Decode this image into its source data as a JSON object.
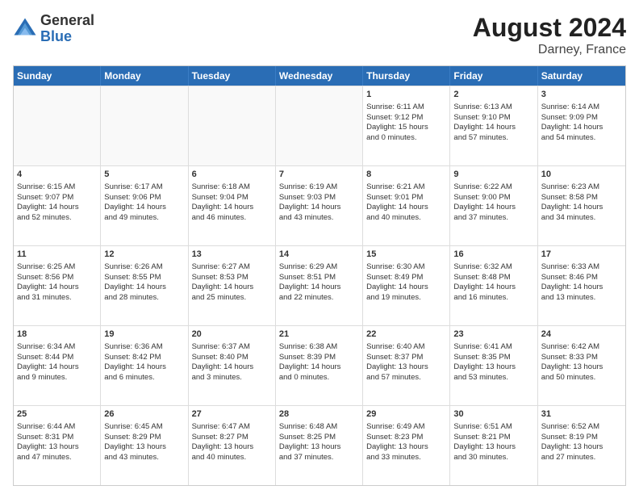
{
  "header": {
    "logo_general": "General",
    "logo_blue": "Blue",
    "title": "August 2024",
    "location": "Darney, France"
  },
  "days_of_week": [
    "Sunday",
    "Monday",
    "Tuesday",
    "Wednesday",
    "Thursday",
    "Friday",
    "Saturday"
  ],
  "weeks": [
    [
      {
        "num": "",
        "lines": [],
        "empty": true
      },
      {
        "num": "",
        "lines": [],
        "empty": true
      },
      {
        "num": "",
        "lines": [],
        "empty": true
      },
      {
        "num": "",
        "lines": [],
        "empty": true
      },
      {
        "num": "1",
        "lines": [
          "Sunrise: 6:11 AM",
          "Sunset: 9:12 PM",
          "Daylight: 15 hours",
          "and 0 minutes."
        ],
        "empty": false
      },
      {
        "num": "2",
        "lines": [
          "Sunrise: 6:13 AM",
          "Sunset: 9:10 PM",
          "Daylight: 14 hours",
          "and 57 minutes."
        ],
        "empty": false
      },
      {
        "num": "3",
        "lines": [
          "Sunrise: 6:14 AM",
          "Sunset: 9:09 PM",
          "Daylight: 14 hours",
          "and 54 minutes."
        ],
        "empty": false
      }
    ],
    [
      {
        "num": "4",
        "lines": [
          "Sunrise: 6:15 AM",
          "Sunset: 9:07 PM",
          "Daylight: 14 hours",
          "and 52 minutes."
        ],
        "empty": false
      },
      {
        "num": "5",
        "lines": [
          "Sunrise: 6:17 AM",
          "Sunset: 9:06 PM",
          "Daylight: 14 hours",
          "and 49 minutes."
        ],
        "empty": false
      },
      {
        "num": "6",
        "lines": [
          "Sunrise: 6:18 AM",
          "Sunset: 9:04 PM",
          "Daylight: 14 hours",
          "and 46 minutes."
        ],
        "empty": false
      },
      {
        "num": "7",
        "lines": [
          "Sunrise: 6:19 AM",
          "Sunset: 9:03 PM",
          "Daylight: 14 hours",
          "and 43 minutes."
        ],
        "empty": false
      },
      {
        "num": "8",
        "lines": [
          "Sunrise: 6:21 AM",
          "Sunset: 9:01 PM",
          "Daylight: 14 hours",
          "and 40 minutes."
        ],
        "empty": false
      },
      {
        "num": "9",
        "lines": [
          "Sunrise: 6:22 AM",
          "Sunset: 9:00 PM",
          "Daylight: 14 hours",
          "and 37 minutes."
        ],
        "empty": false
      },
      {
        "num": "10",
        "lines": [
          "Sunrise: 6:23 AM",
          "Sunset: 8:58 PM",
          "Daylight: 14 hours",
          "and 34 minutes."
        ],
        "empty": false
      }
    ],
    [
      {
        "num": "11",
        "lines": [
          "Sunrise: 6:25 AM",
          "Sunset: 8:56 PM",
          "Daylight: 14 hours",
          "and 31 minutes."
        ],
        "empty": false
      },
      {
        "num": "12",
        "lines": [
          "Sunrise: 6:26 AM",
          "Sunset: 8:55 PM",
          "Daylight: 14 hours",
          "and 28 minutes."
        ],
        "empty": false
      },
      {
        "num": "13",
        "lines": [
          "Sunrise: 6:27 AM",
          "Sunset: 8:53 PM",
          "Daylight: 14 hours",
          "and 25 minutes."
        ],
        "empty": false
      },
      {
        "num": "14",
        "lines": [
          "Sunrise: 6:29 AM",
          "Sunset: 8:51 PM",
          "Daylight: 14 hours",
          "and 22 minutes."
        ],
        "empty": false
      },
      {
        "num": "15",
        "lines": [
          "Sunrise: 6:30 AM",
          "Sunset: 8:49 PM",
          "Daylight: 14 hours",
          "and 19 minutes."
        ],
        "empty": false
      },
      {
        "num": "16",
        "lines": [
          "Sunrise: 6:32 AM",
          "Sunset: 8:48 PM",
          "Daylight: 14 hours",
          "and 16 minutes."
        ],
        "empty": false
      },
      {
        "num": "17",
        "lines": [
          "Sunrise: 6:33 AM",
          "Sunset: 8:46 PM",
          "Daylight: 14 hours",
          "and 13 minutes."
        ],
        "empty": false
      }
    ],
    [
      {
        "num": "18",
        "lines": [
          "Sunrise: 6:34 AM",
          "Sunset: 8:44 PM",
          "Daylight: 14 hours",
          "and 9 minutes."
        ],
        "empty": false
      },
      {
        "num": "19",
        "lines": [
          "Sunrise: 6:36 AM",
          "Sunset: 8:42 PM",
          "Daylight: 14 hours",
          "and 6 minutes."
        ],
        "empty": false
      },
      {
        "num": "20",
        "lines": [
          "Sunrise: 6:37 AM",
          "Sunset: 8:40 PM",
          "Daylight: 14 hours",
          "and 3 minutes."
        ],
        "empty": false
      },
      {
        "num": "21",
        "lines": [
          "Sunrise: 6:38 AM",
          "Sunset: 8:39 PM",
          "Daylight: 14 hours",
          "and 0 minutes."
        ],
        "empty": false
      },
      {
        "num": "22",
        "lines": [
          "Sunrise: 6:40 AM",
          "Sunset: 8:37 PM",
          "Daylight: 13 hours",
          "and 57 minutes."
        ],
        "empty": false
      },
      {
        "num": "23",
        "lines": [
          "Sunrise: 6:41 AM",
          "Sunset: 8:35 PM",
          "Daylight: 13 hours",
          "and 53 minutes."
        ],
        "empty": false
      },
      {
        "num": "24",
        "lines": [
          "Sunrise: 6:42 AM",
          "Sunset: 8:33 PM",
          "Daylight: 13 hours",
          "and 50 minutes."
        ],
        "empty": false
      }
    ],
    [
      {
        "num": "25",
        "lines": [
          "Sunrise: 6:44 AM",
          "Sunset: 8:31 PM",
          "Daylight: 13 hours",
          "and 47 minutes."
        ],
        "empty": false
      },
      {
        "num": "26",
        "lines": [
          "Sunrise: 6:45 AM",
          "Sunset: 8:29 PM",
          "Daylight: 13 hours",
          "and 43 minutes."
        ],
        "empty": false
      },
      {
        "num": "27",
        "lines": [
          "Sunrise: 6:47 AM",
          "Sunset: 8:27 PM",
          "Daylight: 13 hours",
          "and 40 minutes."
        ],
        "empty": false
      },
      {
        "num": "28",
        "lines": [
          "Sunrise: 6:48 AM",
          "Sunset: 8:25 PM",
          "Daylight: 13 hours",
          "and 37 minutes."
        ],
        "empty": false
      },
      {
        "num": "29",
        "lines": [
          "Sunrise: 6:49 AM",
          "Sunset: 8:23 PM",
          "Daylight: 13 hours",
          "and 33 minutes."
        ],
        "empty": false
      },
      {
        "num": "30",
        "lines": [
          "Sunrise: 6:51 AM",
          "Sunset: 8:21 PM",
          "Daylight: 13 hours",
          "and 30 minutes."
        ],
        "empty": false
      },
      {
        "num": "31",
        "lines": [
          "Sunrise: 6:52 AM",
          "Sunset: 8:19 PM",
          "Daylight: 13 hours",
          "and 27 minutes."
        ],
        "empty": false
      }
    ]
  ]
}
